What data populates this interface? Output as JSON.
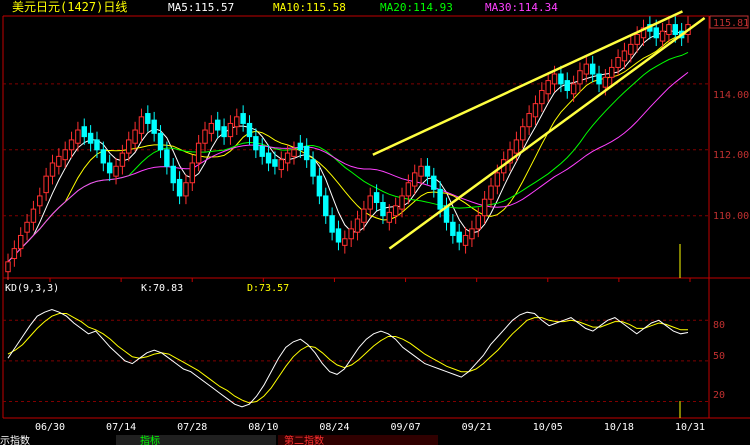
{
  "header": {
    "title": "美元日元(1427)日线",
    "ma": [
      {
        "label": "MA5:115.57",
        "color": "#ffffff"
      },
      {
        "label": "MA10:115.58",
        "color": "#ffff00"
      },
      {
        "label": "MA20:114.93",
        "color": "#00ff00"
      },
      {
        "label": "MA30:114.34",
        "color": "#ff40ff"
      }
    ]
  },
  "price_panel": {
    "yticks": [
      "114.00",
      "112.00",
      "110.00"
    ],
    "last_price": "115.81"
  },
  "kd_panel": {
    "title": "KD(9,3,3)",
    "k_label": "K:70.83",
    "d_label": "D:73.57",
    "yticks": [
      "80",
      "50",
      "20"
    ]
  },
  "xaxis": {
    "labels": [
      "06/30",
      "07/14",
      "07/28",
      "08/10",
      "08/24",
      "09/07",
      "09/21",
      "10/05",
      "10/18",
      "10/31"
    ]
  },
  "bottom_bar": {
    "tab1": "示指数",
    "tab2": "指标",
    "tab3": "第二指数"
  },
  "colors": {
    "up": "#ff3030",
    "down": "#00ffff",
    "axis": "#c00000",
    "trend": "#ffff40",
    "k_line": "#ffffff",
    "d_line": "#ffff00"
  },
  "chart_data": {
    "type": "candlestick",
    "price": {
      "ylim": [
        108.2,
        116.0
      ],
      "close": [
        108.6,
        109.0,
        109.4,
        109.8,
        110.2,
        110.6,
        111.2,
        111.6,
        111.8,
        112.0,
        112.3,
        112.6,
        112.4,
        112.2,
        112.0,
        111.6,
        111.3,
        111.5,
        111.9,
        112.3,
        112.6,
        113.0,
        112.8,
        112.5,
        112.0,
        111.5,
        111.0,
        110.6,
        111.0,
        111.6,
        112.2,
        112.6,
        112.8,
        112.6,
        112.4,
        112.8,
        113.0,
        112.8,
        112.4,
        112.0,
        111.8,
        111.6,
        111.5,
        111.7,
        111.9,
        112.0,
        112.0,
        111.7,
        111.2,
        110.6,
        110.0,
        109.5,
        109.2,
        109.3,
        109.6,
        109.9,
        110.2,
        110.6,
        110.4,
        110.0,
        110.1,
        110.3,
        110.6,
        111.0,
        111.3,
        111.5,
        111.2,
        110.8,
        110.2,
        109.8,
        109.4,
        109.2,
        109.4,
        109.6,
        110.0,
        110.5,
        110.9,
        111.3,
        111.7,
        112.0,
        112.3,
        112.7,
        113.1,
        113.4,
        113.8,
        114.1,
        114.3,
        114.0,
        113.8,
        114.0,
        114.4,
        114.6,
        114.3,
        114.0,
        114.2,
        114.5,
        114.8,
        115.0,
        115.2,
        115.5,
        115.7,
        115.6,
        115.4,
        115.6,
        115.8,
        115.5,
        115.4,
        115.8
      ],
      "open_offset": [
        -0.3,
        -0.3,
        -0.4,
        -0.3,
        -0.4,
        -0.3,
        -0.5,
        -0.4,
        -0.3,
        -0.3,
        -0.3,
        -0.4,
        0.3,
        0.3,
        0.3,
        0.4,
        0.3,
        -0.3,
        -0.4,
        -0.4,
        -0.4,
        -0.5,
        0.3,
        0.4,
        0.5,
        0.5,
        0.5,
        0.5,
        -0.4,
        -0.6,
        -0.6,
        -0.4,
        -0.3,
        0.3,
        0.3,
        -0.4,
        -0.3,
        0.3,
        0.4,
        0.4,
        0.3,
        0.3,
        0.2,
        -0.3,
        -0.3,
        -0.2,
        0.2,
        0.4,
        0.5,
        0.6,
        0.6,
        0.5,
        0.4,
        -0.2,
        -0.3,
        -0.4,
        -0.4,
        -0.4,
        0.3,
        0.4,
        -0.3,
        -0.3,
        -0.4,
        -0.4,
        -0.4,
        -0.3,
        0.3,
        0.4,
        0.6,
        0.5,
        0.4,
        0.3,
        -0.3,
        -0.3,
        -0.4,
        -0.5,
        -0.4,
        -0.4,
        -0.4,
        -0.4,
        -0.4,
        -0.4,
        -0.4,
        -0.4,
        -0.4,
        -0.4,
        -0.3,
        0.3,
        0.3,
        -0.3,
        -0.4,
        -0.3,
        0.3,
        0.3,
        -0.3,
        -0.3,
        -0.3,
        -0.3,
        -0.3,
        -0.3,
        -0.3,
        0.2,
        0.3,
        -0.3,
        -0.3,
        0.3,
        0.2,
        -0.3
      ]
    },
    "ma_series": [
      {
        "name": "MA5",
        "period": 5,
        "color": "#ffffff"
      },
      {
        "name": "MA10",
        "period": 10,
        "color": "#ffff00"
      },
      {
        "name": "MA20",
        "period": 20,
        "color": "#00ff00"
      },
      {
        "name": "MA30",
        "period": 30,
        "color": "#ff40ff"
      }
    ],
    "kd": {
      "ylim": [
        10,
        95
      ],
      "k": [
        52,
        60,
        68,
        76,
        83,
        86,
        88,
        86,
        83,
        78,
        74,
        70,
        72,
        66,
        60,
        55,
        50,
        48,
        52,
        56,
        58,
        56,
        52,
        48,
        44,
        42,
        38,
        34,
        30,
        26,
        22,
        18,
        16,
        18,
        24,
        32,
        42,
        52,
        60,
        64,
        66,
        62,
        56,
        48,
        42,
        40,
        44,
        52,
        60,
        66,
        70,
        72,
        70,
        66,
        60,
        56,
        52,
        48,
        46,
        44,
        42,
        40,
        38,
        42,
        48,
        54,
        62,
        68,
        74,
        80,
        84,
        86,
        85,
        80,
        76,
        78,
        80,
        82,
        78,
        74,
        72,
        76,
        80,
        82,
        78,
        74,
        70,
        74,
        78,
        80,
        76,
        72,
        70,
        71
      ],
      "d": [
        55,
        58,
        62,
        68,
        74,
        79,
        83,
        85,
        85,
        82,
        79,
        75,
        73,
        70,
        66,
        61,
        57,
        53,
        52,
        53,
        55,
        56,
        55,
        52,
        49,
        46,
        43,
        39,
        35,
        31,
        28,
        24,
        21,
        19,
        20,
        24,
        30,
        38,
        46,
        53,
        58,
        61,
        60,
        56,
        51,
        47,
        45,
        47,
        51,
        56,
        61,
        65,
        68,
        68,
        66,
        63,
        59,
        55,
        52,
        49,
        46,
        44,
        42,
        42,
        44,
        48,
        53,
        58,
        64,
        70,
        75,
        80,
        82,
        82,
        80,
        79,
        79,
        80,
        79,
        77,
        75,
        75,
        77,
        79,
        79,
        77,
        74,
        74,
        76,
        78,
        77,
        75,
        73,
        73
      ]
    },
    "trend_lines": [
      {
        "name": "upper",
        "points": [
          [
            "09/04",
            111.85
          ],
          [
            "10/30",
            116.2
          ]
        ]
      },
      {
        "name": "lower",
        "points": [
          [
            "09/07",
            109.0
          ],
          [
            "11/03",
            116.0
          ]
        ]
      }
    ],
    "x_tick_labels": [
      "06/30",
      "07/14",
      "07/28",
      "08/10",
      "08/24",
      "09/07",
      "09/21",
      "10/05",
      "10/18",
      "10/31"
    ]
  }
}
